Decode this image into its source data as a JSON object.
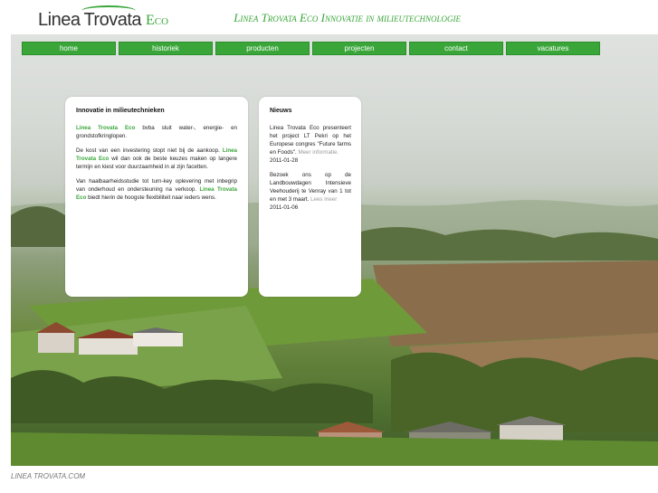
{
  "header": {
    "logo_linea": "Linea",
    "logo_trovata": "Trovata",
    "logo_eco": "Eco",
    "tagline": "Linea Trovata Eco Innovatie in milieutechnologie"
  },
  "nav": {
    "items": [
      {
        "label": "home"
      },
      {
        "label": "historiek"
      },
      {
        "label": "producten"
      },
      {
        "label": "projecten"
      },
      {
        "label": "contact"
      },
      {
        "label": "vacatures"
      }
    ]
  },
  "intro_panel": {
    "title": "Innovatie in milieutechnieken",
    "p1_brand": "Linea Trovata Eco",
    "p1_text": " bvba sluit water-, energie- en grondstofkringlopen.",
    "p2_text": "De kost van een investering stopt niet bij de aankoop. ",
    "p2_brand": "Linea Trovata Eco",
    "p2_text2": " wil dan ook de beste keuzes maken op langere termijn en kiest voor duurzaamheid in al zijn facetten.",
    "p3_text": "Van haalbaarheidsstudie tot turn-key oplevering met inbegrip van onderhoud en ondersteuning na verkoop. ",
    "p3_brand": "Linea Trovata Eco",
    "p3_text2": " biedt hierin de hoogste flexibiliteit naar ieders wens."
  },
  "news_panel": {
    "title": "Nieuws",
    "item1_text": "Linea Trovata Eco presenteert het project LT Pekri op het Europese congres \"Future farms en Foods\". ",
    "item1_link": "Meer informatie.",
    "item1_date": "2011-01-28",
    "item2_text": "Bezoek ons op de Landbouwdagen Intensieve Veehouderij te Venray van 1 tot en met 3 maart. ",
    "item2_link": "Lees meer",
    "item2_date": "2011-01-06"
  },
  "footer": {
    "text": "LINEA TROVATA.COM"
  },
  "colors": {
    "accent": "#3aa63a",
    "nav_bg": "#3aa63a"
  }
}
